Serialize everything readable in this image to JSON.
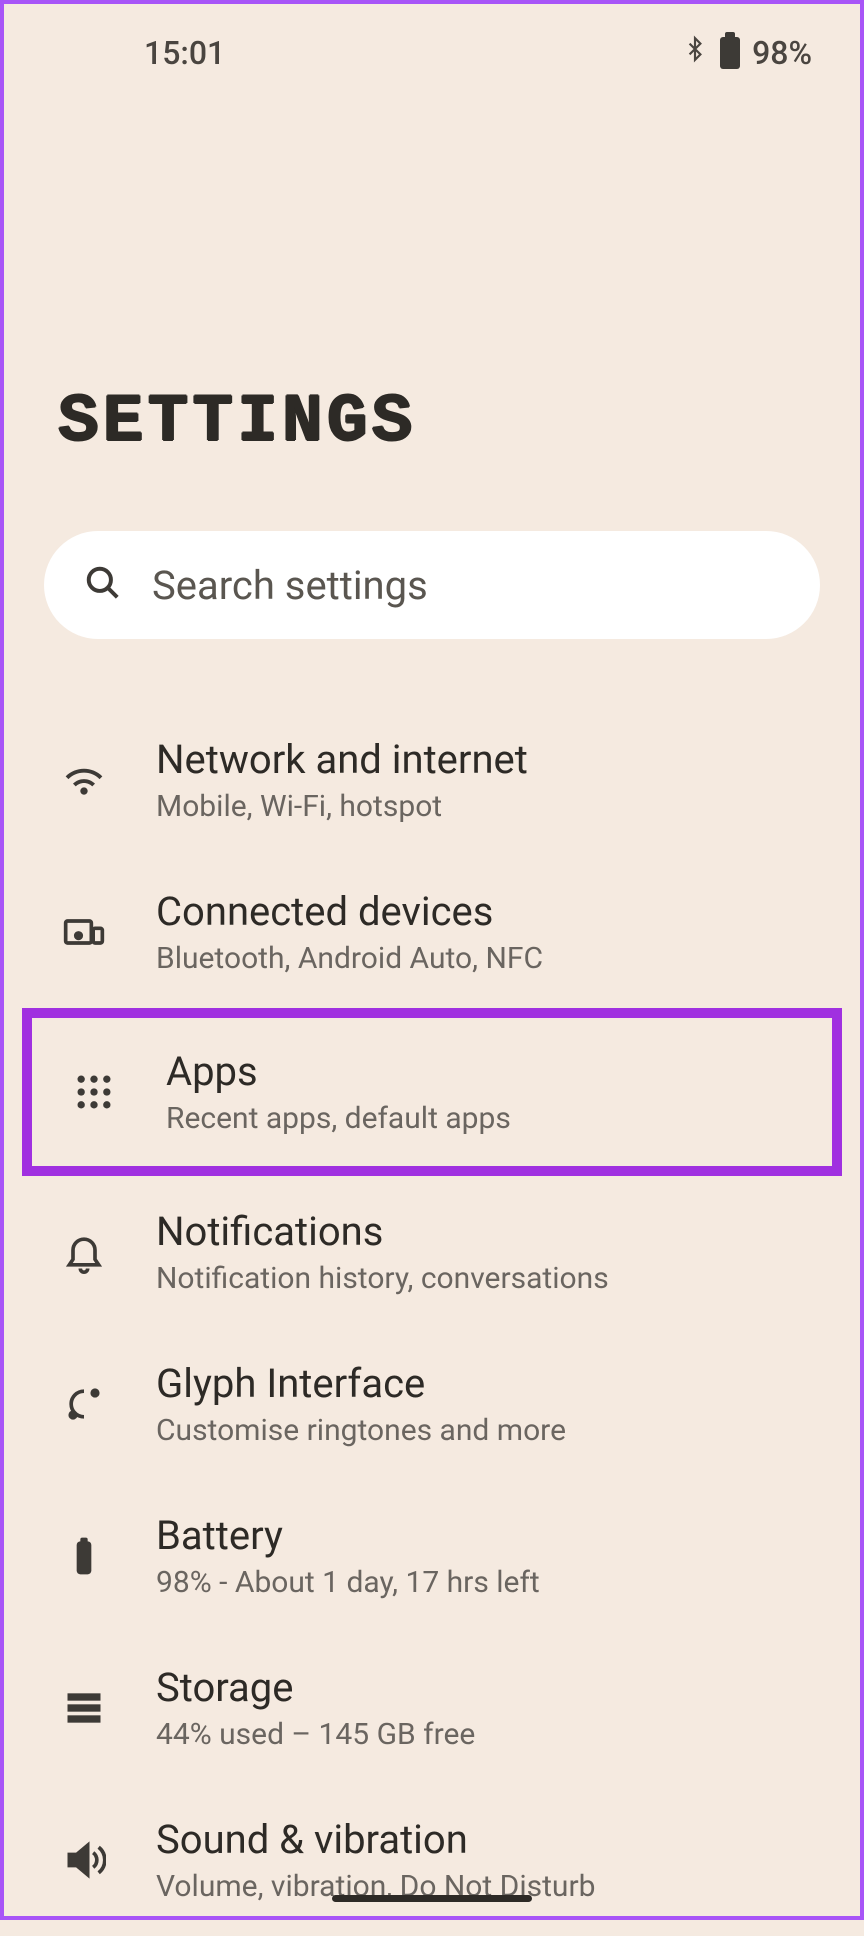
{
  "statusBar": {
    "time": "15:01",
    "batteryPercent": "98%"
  },
  "page": {
    "title": "SETTINGS"
  },
  "search": {
    "placeholder": "Search settings"
  },
  "settings": {
    "items": [
      {
        "icon": "wifi-icon",
        "title": "Network and internet",
        "subtitle": "Mobile, Wi-Fi, hotspot",
        "highlighted": false
      },
      {
        "icon": "devices-icon",
        "title": "Connected devices",
        "subtitle": "Bluetooth, Android Auto, NFC",
        "highlighted": false
      },
      {
        "icon": "apps-icon",
        "title": "Apps",
        "subtitle": "Recent apps, default apps",
        "highlighted": true
      },
      {
        "icon": "bell-icon",
        "title": "Notifications",
        "subtitle": "Notification history, conversations",
        "highlighted": false
      },
      {
        "icon": "glyph-icon",
        "title": "Glyph Interface",
        "subtitle": "Customise ringtones and more",
        "highlighted": false
      },
      {
        "icon": "battery-icon",
        "title": "Battery",
        "subtitle": "98% - About 1 day, 17 hrs left",
        "highlighted": false
      },
      {
        "icon": "storage-icon",
        "title": "Storage",
        "subtitle": "44% used – 145 GB free",
        "highlighted": false
      },
      {
        "icon": "sound-icon",
        "title": "Sound & vibration",
        "subtitle": "Volume, vibration, Do Not Disturb",
        "highlighted": false
      }
    ]
  }
}
